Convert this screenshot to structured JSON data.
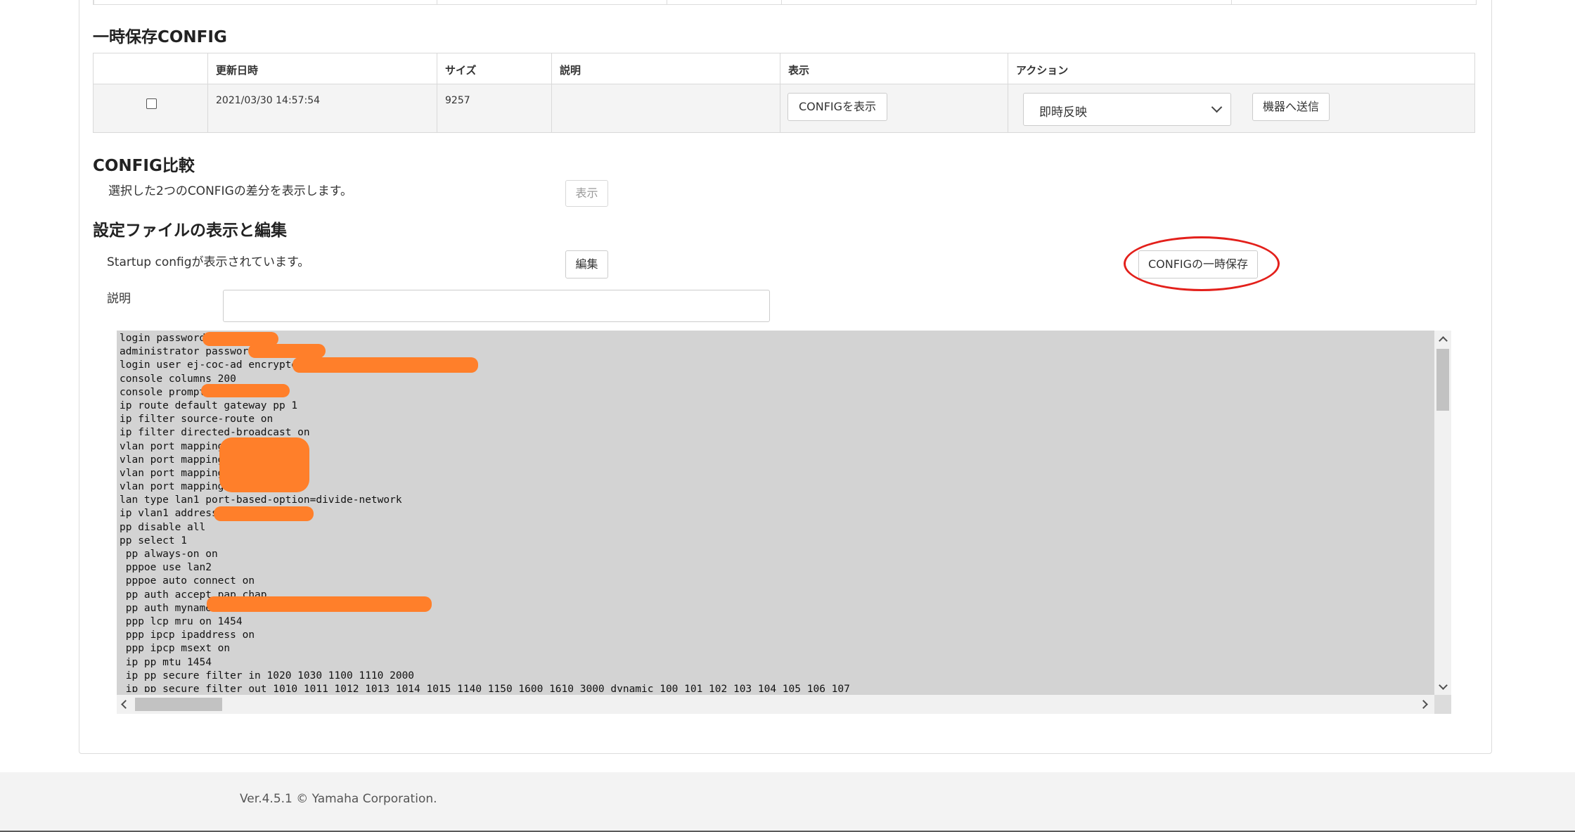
{
  "temp_config": {
    "title": "一時保存CONFIG",
    "headers": {
      "updated": "更新日時",
      "size": "サイズ",
      "description": "説明",
      "display": "表示",
      "action": "アクション"
    },
    "row": {
      "updated": "2021/03/30 14:57:54",
      "size": "9257",
      "description": "",
      "show_button": "CONFIGを表示",
      "action_selected": "即時反映",
      "send_button": "機器へ送信"
    }
  },
  "compare": {
    "title": "CONFIG比較",
    "description": "選択した2つのCONFIGの差分を表示します。",
    "show_button": "表示"
  },
  "edit": {
    "title": "設定ファイルの表示と編集",
    "status": "Startup configが表示されています。",
    "edit_button": "編集",
    "save_temp_button": "CONFIGの一時保存",
    "desc_label": "説明",
    "desc_value": "",
    "config_lines": [
      "login password ",
      "administrator password ",
      "login user ej-coc-ad encrypted ",
      "console columns 200",
      "console prompt ",
      "ip route default gateway pp 1",
      "ip filter source-route on",
      "ip filter directed-broadcast on",
      "vlan port mapping ",
      "vlan port mapping ",
      "vlan port mapping ",
      "vlan port mapping ",
      "lan type lan1 port-based-option=divide-network",
      "ip vlan1 address ",
      "pp disable all",
      "pp select 1",
      " pp always-on on",
      " pppoe use lan2",
      " pppoe auto connect on",
      " pp auth accept pap chap",
      " pp auth myname ",
      " ppp lcp mru on 1454",
      " ppp ipcp ipaddress on",
      " ppp ipcp msext on",
      " ip pp mtu 1454",
      " ip pp secure filter in 1020 1030 1100 1110 2000",
      " ip pp secure filter out 1010 1011 1012 1013 1014 1015 1140 1150 1600 1610 3000 dynamic 100 101 102 103 104 105 106 107"
    ]
  },
  "footer": {
    "version": "Ver.4.5.1  © Yamaha Corporation."
  },
  "colors": {
    "highlight": "#e3201b",
    "redaction": "#ff7f2a",
    "editor_bg": "#d3d3d3",
    "footer_bg": "#f3f3f3"
  },
  "icons": {
    "select_chevron": "chevron-down-icon",
    "scroll_up": "arrow-up-icon",
    "scroll_down": "arrow-down-icon",
    "scroll_left": "arrow-left-icon",
    "scroll_right": "arrow-right-icon"
  }
}
